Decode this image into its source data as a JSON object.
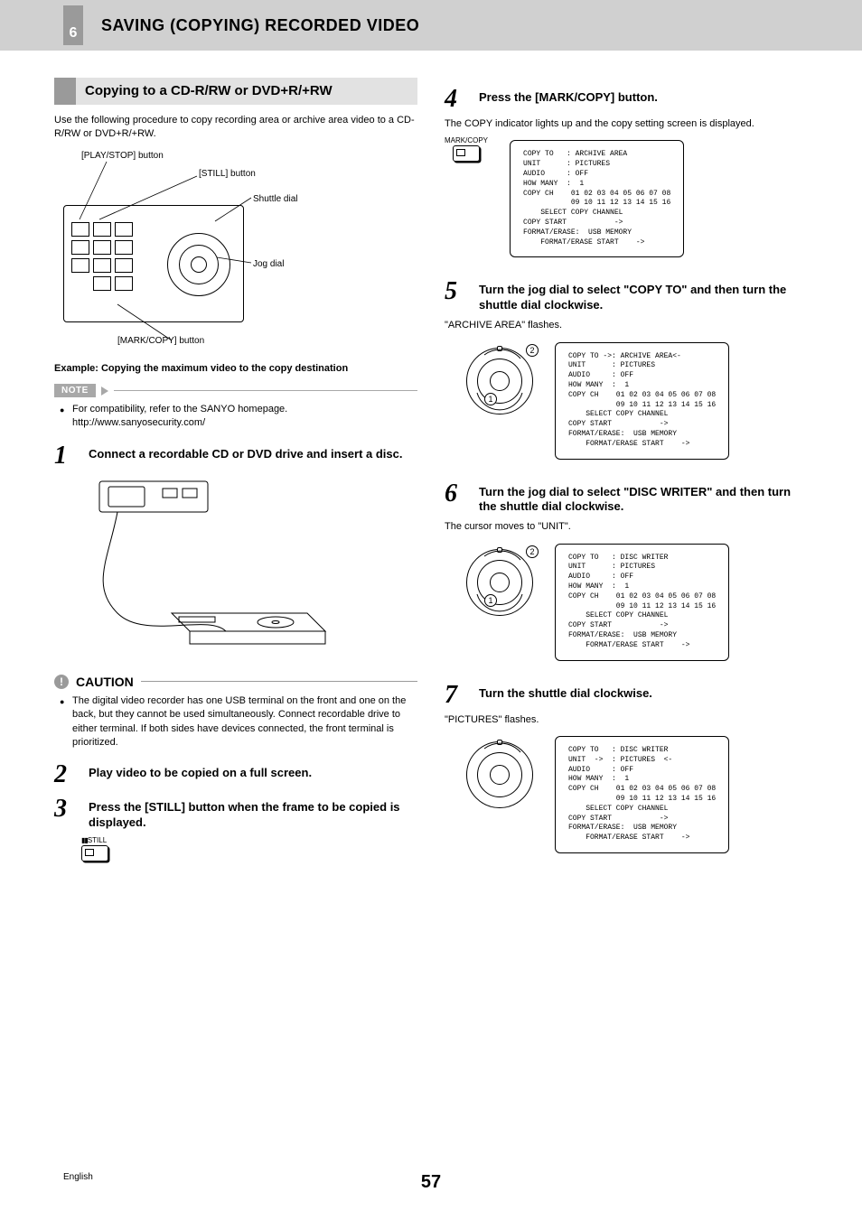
{
  "header": {
    "chapter_number": "6",
    "chapter_title": "SAVING (COPYING) RECORDED VIDEO"
  },
  "section_title": "Copying to a CD-R/RW or DVD+R/+RW",
  "intro": "Use the following procedure to copy recording area or archive area video to a CD-R/RW or DVD+R/+RW.",
  "diagram_labels": {
    "play_stop": "[PLAY/STOP] button",
    "still": "[STILL] button",
    "shuttle": "Shuttle dial",
    "jog": "Jog dial",
    "mark_copy": "[MARK/COPY] button"
  },
  "example_text": "Example: Copying the maximum video to the copy destination",
  "note_label": "NOTE",
  "note_items": [
    "For compatibility, refer to the SANYO homepage. http://www.sanyosecurity.com/"
  ],
  "caution_label": "CAUTION",
  "caution_items": [
    "The digital video recorder has one USB terminal on the front and one on the back, but they cannot be used simultaneously. Connect recordable drive to either terminal. If both sides have devices connected, the front terminal is prioritized."
  ],
  "steps": {
    "s1": {
      "num": "1",
      "title": "Connect a recordable CD or DVD drive and insert a disc."
    },
    "s2": {
      "num": "2",
      "title": "Play video to be copied on a full screen."
    },
    "s3": {
      "num": "3",
      "title": "Press the [STILL] button when the frame to be copied is displayed."
    },
    "s3_button_label": "STILL",
    "s4": {
      "num": "4",
      "title": "Press the [MARK/COPY] button.",
      "body": "The COPY indicator lights up and the copy setting screen is displayed."
    },
    "s4_button_label": "MARK/COPY",
    "s5": {
      "num": "5",
      "title": "Turn the jog dial to select \"COPY TO\" and then turn the shuttle dial clockwise.",
      "body": "\"ARCHIVE AREA\" flashes."
    },
    "s6": {
      "num": "6",
      "title": "Turn the jog dial to select \"DISC WRITER\" and then turn the shuttle dial clockwise.",
      "body": "The cursor moves to \"UNIT\"."
    },
    "s7": {
      "num": "7",
      "title": "Turn the shuttle dial clockwise.",
      "body": "\"PICTURES\" flashes."
    }
  },
  "osd": {
    "screen4": "COPY TO   : ARCHIVE AREA\nUNIT      : PICTURES\nAUDIO     : OFF\nHOW MANY  :  1\nCOPY CH    01 02 03 04 05 06 07 08\n           09 10 11 12 13 14 15 16\n    SELECT COPY CHANNEL\nCOPY START           ->\nFORMAT/ERASE:  USB MEMORY\n    FORMAT/ERASE START    ->",
    "screen5": "COPY TO ->: ARCHIVE AREA<-\nUNIT      : PICTURES\nAUDIO     : OFF\nHOW MANY  :  1\nCOPY CH    01 02 03 04 05 06 07 08\n           09 10 11 12 13 14 15 16\n    SELECT COPY CHANNEL\nCOPY START           ->\nFORMAT/ERASE:  USB MEMORY\n    FORMAT/ERASE START    ->",
    "screen6": "COPY TO   : DISC WRITER\nUNIT      : PICTURES\nAUDIO     : OFF\nHOW MANY  :  1\nCOPY CH    01 02 03 04 05 06 07 08\n           09 10 11 12 13 14 15 16\n    SELECT COPY CHANNEL\nCOPY START           ->\nFORMAT/ERASE:  USB MEMORY\n    FORMAT/ERASE START    ->",
    "screen7": "COPY TO   : DISC WRITER\nUNIT  ->  : PICTURES  <-\nAUDIO     : OFF\nHOW MANY  :  1\nCOPY CH    01 02 03 04 05 06 07 08\n           09 10 11 12 13 14 15 16\n    SELECT COPY CHANNEL\nCOPY START           ->\nFORMAT/ERASE:  USB MEMORY\n    FORMAT/ERASE START    ->"
  },
  "footer": {
    "language": "English",
    "page": "57"
  }
}
